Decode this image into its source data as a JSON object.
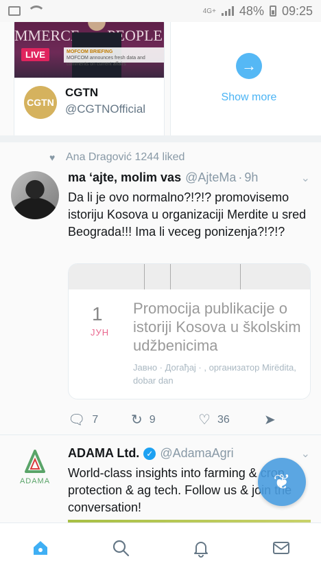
{
  "status_bar": {
    "network": "4G+",
    "battery": "48%",
    "time": "09:25"
  },
  "carousel": {
    "card": {
      "banner_left": "MMERCE",
      "banner_right": "PEOPLE",
      "live_label": "LIVE",
      "ticker_title": "MOFCOM BRIEFING",
      "ticker_text": "MOFCOM announces fresh data and comments on current affairs",
      "logo_text": "CGTN",
      "name": "CGTN",
      "handle": "@CGTNOfficial"
    },
    "more": {
      "label": "Show more"
    }
  },
  "tweet1": {
    "social_context": "Ana Dragović 1244 liked",
    "name": "ma ʻajte, molim vas",
    "handle": "@AjteMa",
    "dot": "·",
    "time": "9h",
    "text": "Da li je ovo normalno?!?!? promovisemo istoriju Kosova u organizaciji Merdite u sred Beograda!!! Ima li veceg ponizenja?!?!?",
    "event": {
      "day": "1",
      "month": "ЈУН",
      "title": "Promocija publikacije o istoriji Kosova u školskim udžbenicima",
      "meta": "Јавно · Догађај · , организатор Mirëdita, dobar dan"
    },
    "actions": {
      "replies": "7",
      "retweets": "9",
      "likes": "36"
    }
  },
  "tweet2": {
    "logo_word": "ADAMA",
    "name": "ADAMA Ltd.",
    "handle": "@AdamaAgri",
    "text": "World-class insights into farming & crop protection & ag tech. Follow us & join the conversation!"
  },
  "colors": {
    "accent": "#1da1f2",
    "like_red": "#e0245e",
    "text": "#14171a",
    "secondary": "#657786"
  },
  "icons": {
    "nav": [
      "home-icon",
      "search-icon",
      "notifications-icon",
      "messages-icon"
    ],
    "fab": "compose-icon"
  }
}
